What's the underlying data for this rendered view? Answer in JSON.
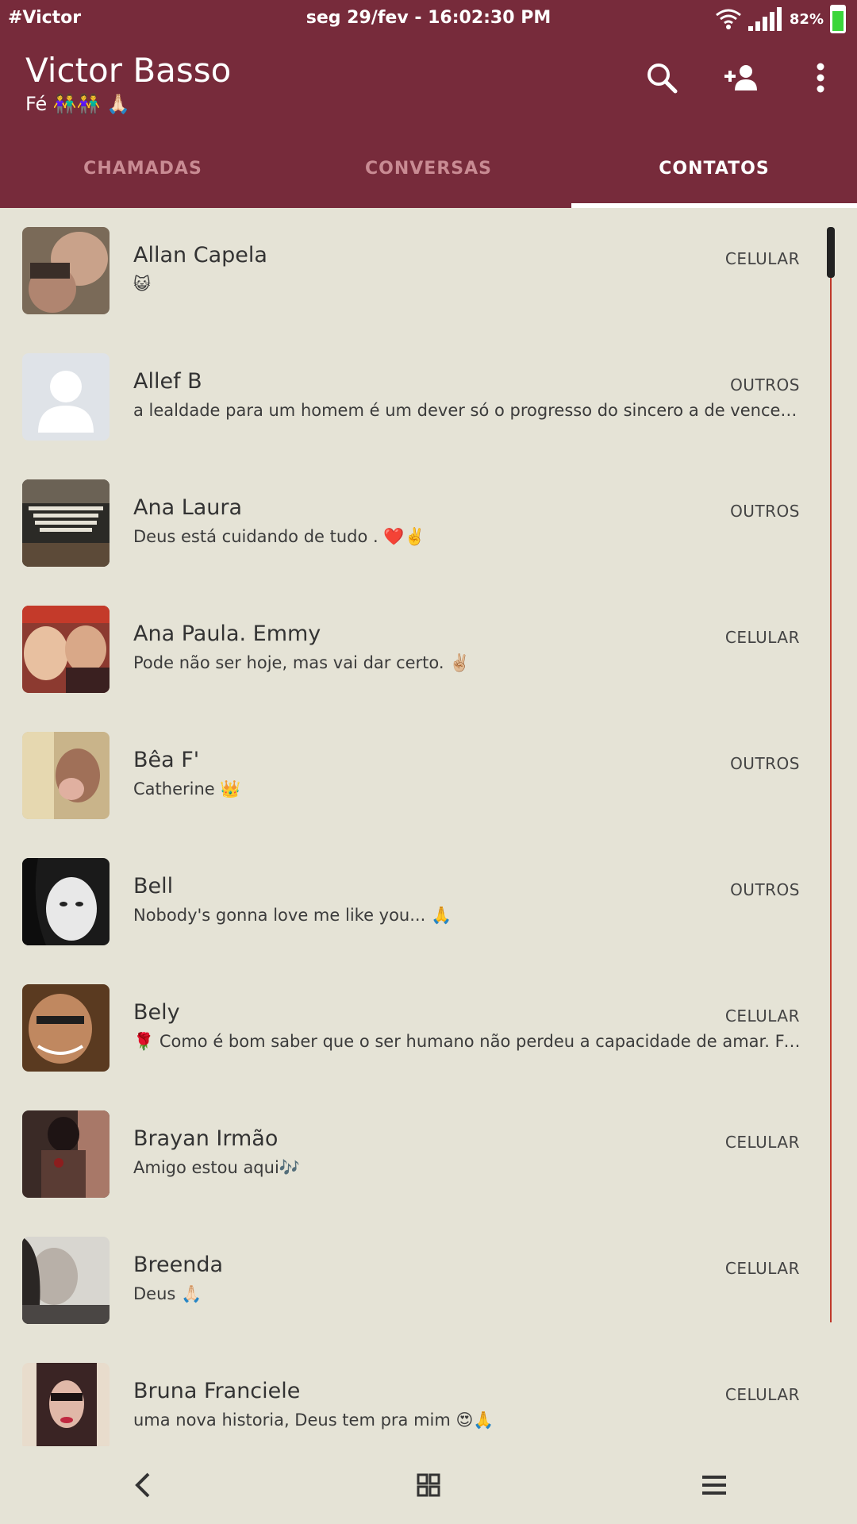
{
  "status_bar": {
    "left_text": "#Victor",
    "datetime": "seg 29/fev - 16:02:30 PM",
    "battery": "82%"
  },
  "header": {
    "title": "Victor Basso",
    "subtitle": "Fé 👫👫 🙏🏻 ",
    "actions": [
      "search-icon",
      "add-contact-icon",
      "more-vert-icon"
    ]
  },
  "tabs": [
    {
      "label": "CHAMADAS",
      "active": false
    },
    {
      "label": "CONVERSAS",
      "active": false
    },
    {
      "label": "CONTATOS",
      "active": true
    }
  ],
  "contacts": [
    {
      "name": "Allan Capela",
      "status": "😺",
      "type": "CELULAR"
    },
    {
      "name": "Allef B",
      "status": "a lealdade para um homem é um dever só o progresso do sincero a de vencer j...",
      "type": "OUTROS"
    },
    {
      "name": "Ana Laura",
      "status": "Deus está cuidando de tudo . ❤️✌️",
      "type": "OUTROS"
    },
    {
      "name": "Ana Paula. Emmy",
      "status": "Pode não ser hoje, mas vai dar certo. ✌🏼",
      "type": "CELULAR"
    },
    {
      "name": "Bêa F'",
      "status": "Catherine 👑",
      "type": "OUTROS"
    },
    {
      "name": "Bell",
      "status": "Nobody's gonna love me like you... 🙏",
      "type": "OUTROS"
    },
    {
      "name": "Bely",
      "status": "🌹 Como é bom saber que o ser humano não perdeu a capacidade de amar.  Fe...",
      "type": "CELULAR"
    },
    {
      "name": "Brayan Irmão",
      "status": "Amigo estou aqui🎶",
      "type": "CELULAR"
    },
    {
      "name": "Breenda",
      "status": "Deus 🙏🏻",
      "type": "CELULAR"
    },
    {
      "name": "Bruna Franciele",
      "status": "uma nova historia, Deus tem pra mim 😍🙏",
      "type": "CELULAR"
    }
  ],
  "colors": {
    "header": "#772b3b",
    "background": "#e5e3d6",
    "tab_inactive": "#c98b93",
    "scroll_track": "#c0392b",
    "battery_fill": "#3ad63a"
  },
  "nav": [
    "back-icon",
    "home-grid-icon",
    "menu-icon"
  ]
}
